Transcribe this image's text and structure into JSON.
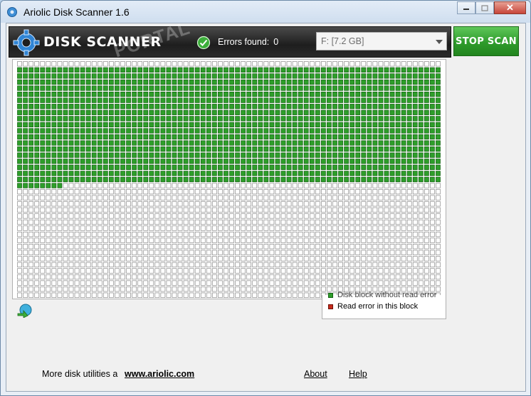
{
  "window": {
    "title": "Ariolic Disk Scanner 1.6",
    "controls": {
      "minimize": "minimize-icon",
      "maximize": "maximize-icon",
      "close": "✕"
    }
  },
  "header": {
    "logo_text": "DISK SCANNER",
    "watermark": "PORTAL",
    "errors_label": "Errors found:",
    "errors_count": "0",
    "drive": "F:  [7.2 GB]",
    "stop_button": "STOP SCAN"
  },
  "scan": {
    "columns": 74,
    "rows": 39,
    "colors": {
      "scanned": "#2e9e2a",
      "scanned_border": "#0f5e0d",
      "unscanned_border": "#8a8a8a",
      "error": "#c62a1b"
    },
    "progress_fraction": 0.49
  },
  "legend": {
    "ok_label": "Disk block without read error",
    "error_label": "Read error in this block"
  },
  "footer": {
    "more_text": "More disk utilities a",
    "site_link": "www.ariolic.com",
    "about_link": "About",
    "help_link": "Help"
  },
  "icons": [
    "app-gear-icon",
    "disk-scanner-gear-icon",
    "scan-status-icon",
    "refresh-icon",
    "chevron-down-icon"
  ]
}
